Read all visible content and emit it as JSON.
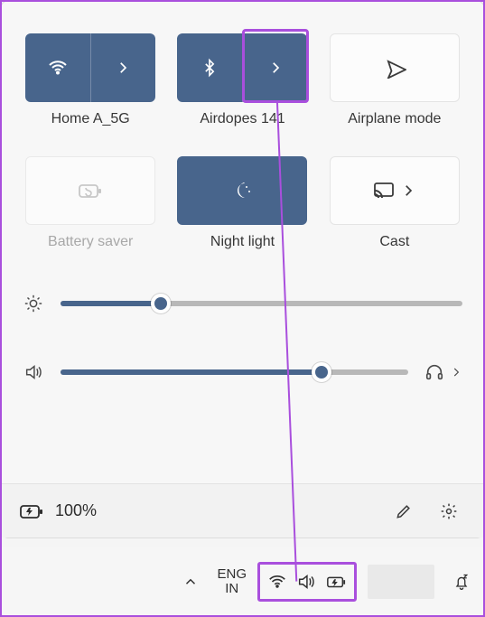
{
  "tiles": [
    {
      "id": "wifi",
      "label": "Home A_5G",
      "state": "active",
      "split": true,
      "icon": "wifi"
    },
    {
      "id": "bluetooth",
      "label": "Airdopes 141",
      "state": "active",
      "split": true,
      "icon": "bluetooth"
    },
    {
      "id": "airplane",
      "label": "Airplane mode",
      "state": "inactive",
      "split": false,
      "icon": "airplane"
    },
    {
      "id": "battery-saver",
      "label": "Battery saver",
      "state": "disabled",
      "split": false,
      "icon": "battery-saver"
    },
    {
      "id": "night-light",
      "label": "Night light",
      "state": "active",
      "split": false,
      "icon": "night-light"
    },
    {
      "id": "cast",
      "label": "Cast",
      "state": "inactive",
      "split": false,
      "icon": "cast",
      "chevron": true
    }
  ],
  "sliders": {
    "brightness": {
      "percent": 25
    },
    "volume": {
      "percent": 75
    }
  },
  "footer": {
    "battery_text": "100%"
  },
  "taskbar": {
    "lang_top": "ENG",
    "lang_bottom": "IN"
  },
  "colors": {
    "accent": "#48658c",
    "highlight": "#a94fdd"
  }
}
